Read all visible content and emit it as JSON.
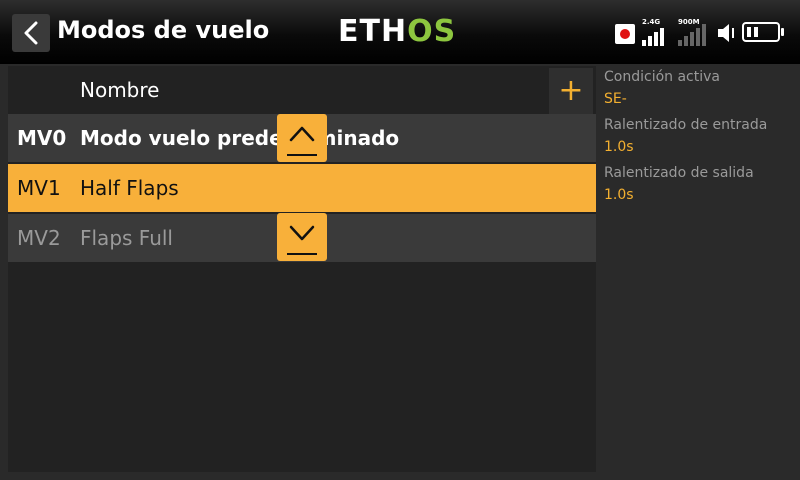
{
  "header": {
    "title": "Modos de vuelo",
    "logo_eth": "ETH",
    "logo_os": "OS",
    "signal_24_label": "2.4G",
    "signal_900_label": "900M"
  },
  "list": {
    "column_name": "Nombre",
    "add_label": "+",
    "rows": [
      {
        "id": "MV0",
        "name": "Modo vuelo predeterminado"
      },
      {
        "id": "MV1",
        "name": "Half Flaps"
      },
      {
        "id": "MV2",
        "name": "Flaps Full"
      }
    ]
  },
  "detail": {
    "active_condition_label": "Condición activa",
    "active_condition_value": "SE-",
    "fade_in_label": "Ralentizado de entrada",
    "fade_in_value": "1.0s",
    "fade_out_label": "Ralentizado de salida",
    "fade_out_value": "1.0s"
  },
  "colors": {
    "accent": "#f8b03a",
    "logo_green": "#8dc63f",
    "record_red": "#e01010"
  }
}
